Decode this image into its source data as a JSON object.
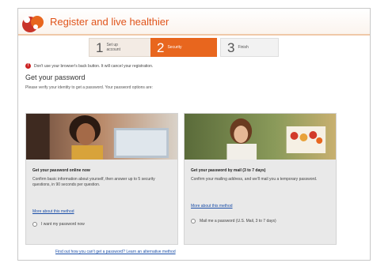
{
  "header": {
    "title": "Register and live healthier"
  },
  "steps": [
    {
      "number": "1",
      "label_line1": "Set up",
      "label_line2": "account"
    },
    {
      "number": "2",
      "label_line1": "Security",
      "label_line2": ""
    },
    {
      "number": "3",
      "label_line1": "Finish",
      "label_line2": ""
    }
  ],
  "warning": {
    "text": "Don't use your browser's back button. It will cancel your registration."
  },
  "section": {
    "title": "Get your password",
    "subtitle": "Please verify your identity to get a password. Your password options are:"
  },
  "online_panel": {
    "heading": "Get your password online now",
    "description": "Confirm basic information about yourself, then answer up to 5 security questions, in 90 seconds per question.",
    "link": "More about this method",
    "radio_label": "I want my password now"
  },
  "mail_panel": {
    "heading": "Get your password by mail (3 to 7 days)",
    "description": "Confirm your mailing address, and we'll mail you a temporary password.",
    "link": "More about this method",
    "radio_label": "Mail me a password (U.S. Mail, 3 to 7 days)"
  },
  "footer": {
    "link": "Find out how you can't get a password? Learn an alternative method"
  },
  "colors": {
    "accent": "#e8661e",
    "title": "#e0541a",
    "link": "#1a4ea8",
    "warning": "#cc2222"
  }
}
